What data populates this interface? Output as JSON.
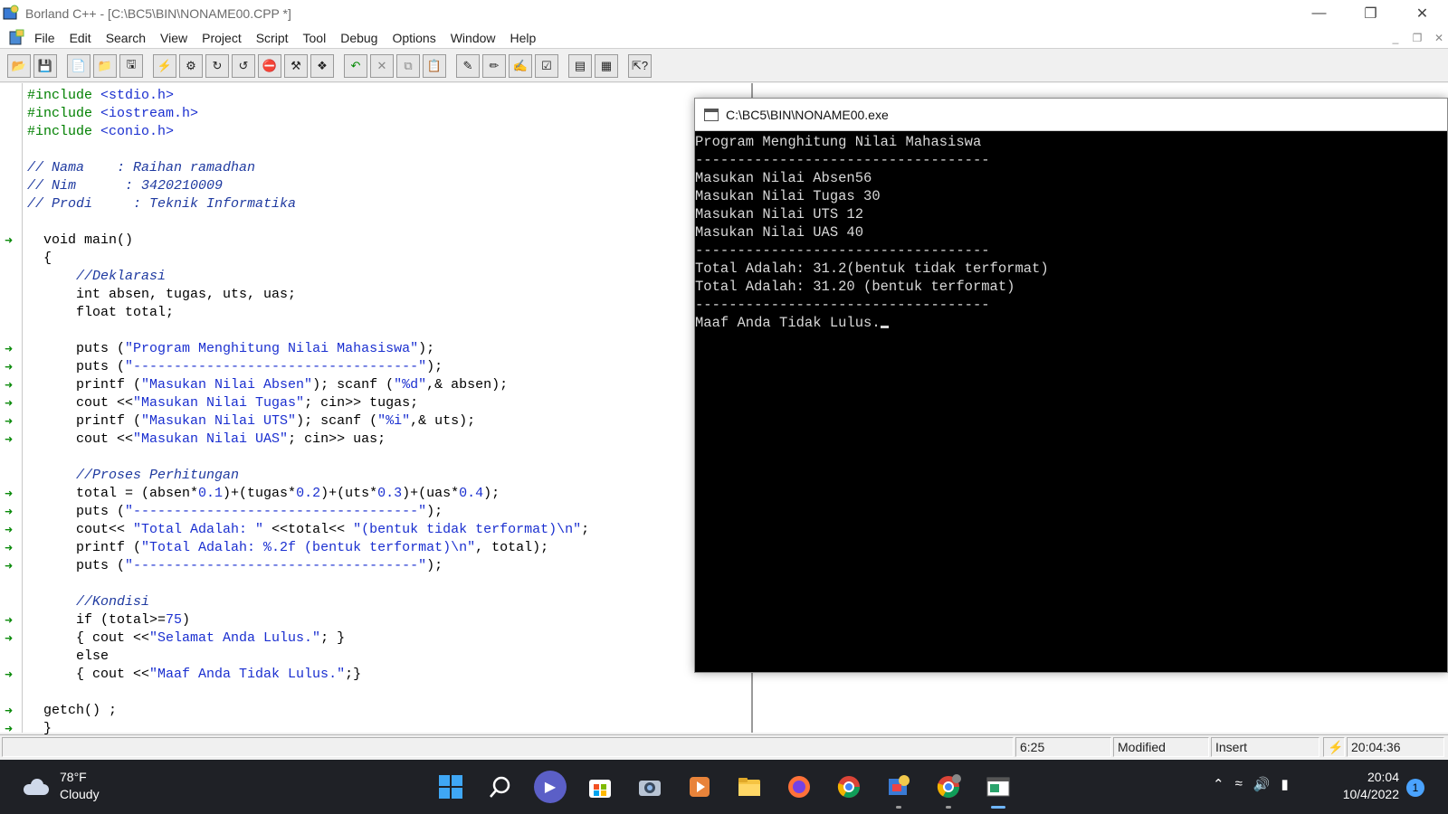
{
  "window": {
    "title": "Borland C++ - [C:\\BC5\\BIN\\NONAME00.CPP *]"
  },
  "menu": [
    "File",
    "Edit",
    "Search",
    "View",
    "Project",
    "Script",
    "Tool",
    "Debug",
    "Options",
    "Window",
    "Help"
  ],
  "editor": {
    "lines": [
      {
        "type": "include",
        "pp": "#include ",
        "file": "<stdio.h>"
      },
      {
        "type": "include",
        "pp": "#include ",
        "file": "<iostream.h>"
      },
      {
        "type": "include",
        "pp": "#include ",
        "file": "<conio.h>"
      },
      {
        "type": "blank"
      },
      {
        "type": "comment",
        "text": "// Nama    : Raihan ramadhan"
      },
      {
        "type": "comment",
        "text": "// Nim      : 3420210009"
      },
      {
        "type": "comment",
        "text": "// Prodi     : Teknik Informatika"
      },
      {
        "type": "blank"
      },
      {
        "type": "code",
        "text": "  void main()"
      },
      {
        "type": "code",
        "text": "  {"
      },
      {
        "type": "comment",
        "text": "      //Deklarasi"
      },
      {
        "type": "code",
        "text": "      int absen, tugas, uts, uas;"
      },
      {
        "type": "code",
        "text": "      float total;"
      },
      {
        "type": "blank"
      },
      {
        "type": "mixed",
        "parts": [
          [
            "code",
            "      puts ("
          ],
          [
            "str",
            "\"Program Menghitung Nilai Mahasiswa\""
          ],
          [
            "code",
            ");"
          ]
        ]
      },
      {
        "type": "mixed",
        "parts": [
          [
            "code",
            "      puts ("
          ],
          [
            "str",
            "\"-----------------------------------\""
          ],
          [
            "code",
            ");"
          ]
        ]
      },
      {
        "type": "mixed",
        "parts": [
          [
            "code",
            "      printf ("
          ],
          [
            "str",
            "\"Masukan Nilai Absen\""
          ],
          [
            "code",
            "); scanf ("
          ],
          [
            "str",
            "\"%d\""
          ],
          [
            "code",
            ",& absen);"
          ]
        ]
      },
      {
        "type": "mixed",
        "parts": [
          [
            "code",
            "      cout <<"
          ],
          [
            "str",
            "\"Masukan Nilai Tugas\""
          ],
          [
            "code",
            "; cin>> tugas;"
          ]
        ]
      },
      {
        "type": "mixed",
        "parts": [
          [
            "code",
            "      printf ("
          ],
          [
            "str",
            "\"Masukan Nilai UTS\""
          ],
          [
            "code",
            "); scanf ("
          ],
          [
            "str",
            "\"%i\""
          ],
          [
            "code",
            ",& uts);"
          ]
        ]
      },
      {
        "type": "mixed",
        "parts": [
          [
            "code",
            "      cout <<"
          ],
          [
            "str",
            "\"Masukan Nilai UAS\""
          ],
          [
            "code",
            "; cin>> uas;"
          ]
        ]
      },
      {
        "type": "blank"
      },
      {
        "type": "comment",
        "text": "      //Proses Perhitungan"
      },
      {
        "type": "mixed",
        "parts": [
          [
            "code",
            "      total = (absen*"
          ],
          [
            "num",
            "0.1"
          ],
          [
            "code",
            ")+(tugas*"
          ],
          [
            "num",
            "0.2"
          ],
          [
            "code",
            ")+(uts*"
          ],
          [
            "num",
            "0.3"
          ],
          [
            "code",
            ")+(uas*"
          ],
          [
            "num",
            "0.4"
          ],
          [
            "code",
            ");"
          ]
        ]
      },
      {
        "type": "mixed",
        "parts": [
          [
            "code",
            "      puts ("
          ],
          [
            "str",
            "\"-----------------------------------\""
          ],
          [
            "code",
            ");"
          ]
        ]
      },
      {
        "type": "mixed",
        "parts": [
          [
            "code",
            "      cout<< "
          ],
          [
            "str",
            "\"Total Adalah: \""
          ],
          [
            "code",
            " <<total<< "
          ],
          [
            "str",
            "\"(bentuk tidak terformat)\\n\""
          ],
          [
            "code",
            ";"
          ]
        ]
      },
      {
        "type": "mixed",
        "parts": [
          [
            "code",
            "      printf ("
          ],
          [
            "str",
            "\"Total Adalah: %.2f (bentuk terformat)\\n\""
          ],
          [
            "code",
            ", total);"
          ]
        ]
      },
      {
        "type": "mixed",
        "parts": [
          [
            "code",
            "      puts ("
          ],
          [
            "str",
            "\"-----------------------------------\""
          ],
          [
            "code",
            ");"
          ]
        ]
      },
      {
        "type": "blank"
      },
      {
        "type": "comment",
        "text": "      //Kondisi"
      },
      {
        "type": "mixed",
        "parts": [
          [
            "code",
            "      if (total>="
          ],
          [
            "num",
            "75"
          ],
          [
            "code",
            ")"
          ]
        ]
      },
      {
        "type": "mixed",
        "parts": [
          [
            "code",
            "      { cout <<"
          ],
          [
            "str",
            "\"Selamat Anda Lulus.\""
          ],
          [
            "code",
            "; }"
          ]
        ]
      },
      {
        "type": "code",
        "text": "      else"
      },
      {
        "type": "mixed",
        "parts": [
          [
            "code",
            "      { cout <<"
          ],
          [
            "str",
            "\"Maaf Anda Tidak Lulus.\""
          ],
          [
            "code",
            ";}"
          ]
        ]
      },
      {
        "type": "blank"
      },
      {
        "type": "code",
        "text": "  getch() ;"
      },
      {
        "type": "code",
        "text": "  }"
      }
    ],
    "breakpoint_lines": [
      8,
      14,
      15,
      16,
      17,
      18,
      19,
      22,
      23,
      24,
      25,
      26,
      29,
      30,
      32,
      34,
      35
    ]
  },
  "console": {
    "title": "C:\\BC5\\BIN\\NONAME00.exe",
    "lines": [
      "Program Menghitung Nilai Mahasiswa",
      "-----------------------------------",
      "Masukan Nilai Absen56",
      "Masukan Nilai Tugas 30",
      "Masukan Nilai UTS 12",
      "Masukan Nilai UAS 40",
      "-----------------------------------",
      "Total Adalah: 31.2(bentuk tidak terformat)",
      "Total Adalah: 31.20 (bentuk terformat)",
      "-----------------------------------",
      "Maaf Anda Tidak Lulus."
    ]
  },
  "statusbar": {
    "position": "6:25",
    "state": "Modified",
    "mode": "Insert",
    "time": "20:04:36"
  },
  "taskbar": {
    "weather_temp": "78°F",
    "weather_desc": "Cloudy",
    "clock_time": "20:04",
    "clock_date": "10/4/2022",
    "notification_count": "1"
  },
  "colors": {
    "console_bg": "#000000",
    "taskbar_bg": "#1f2126",
    "string_color": "#1a2fd0",
    "preprocessor_color": "#008000"
  }
}
